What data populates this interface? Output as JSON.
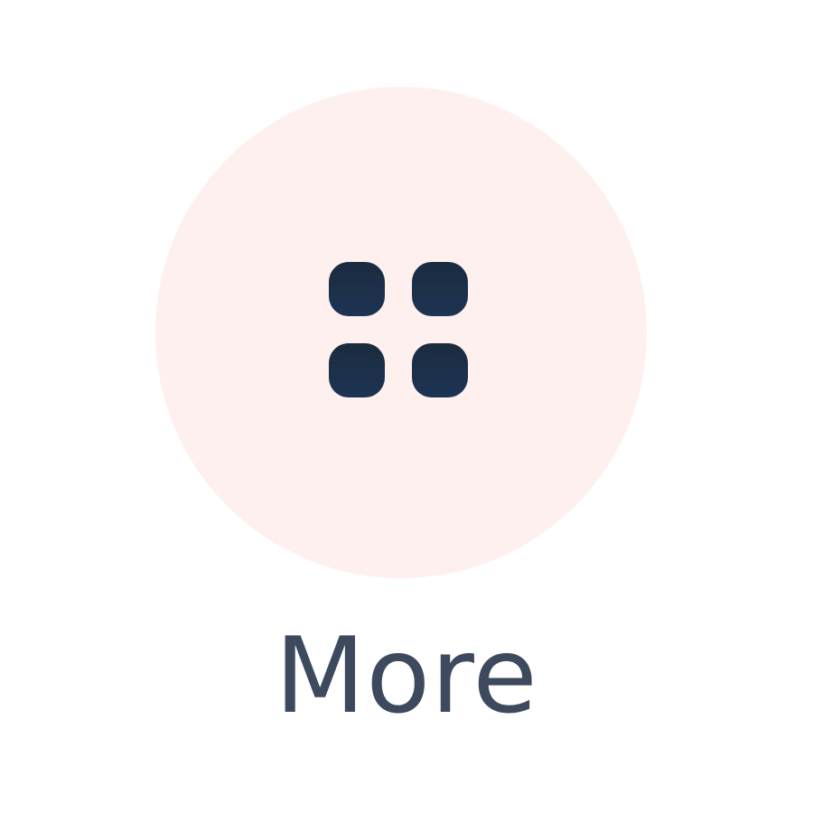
{
  "more_button": {
    "label": "More",
    "icon": "grid-four-squares-icon"
  },
  "colors": {
    "circle_background": "#fdf0ee",
    "icon": "#1b2d45",
    "label": "#3d4a5e",
    "page_background": "#ffffff"
  }
}
